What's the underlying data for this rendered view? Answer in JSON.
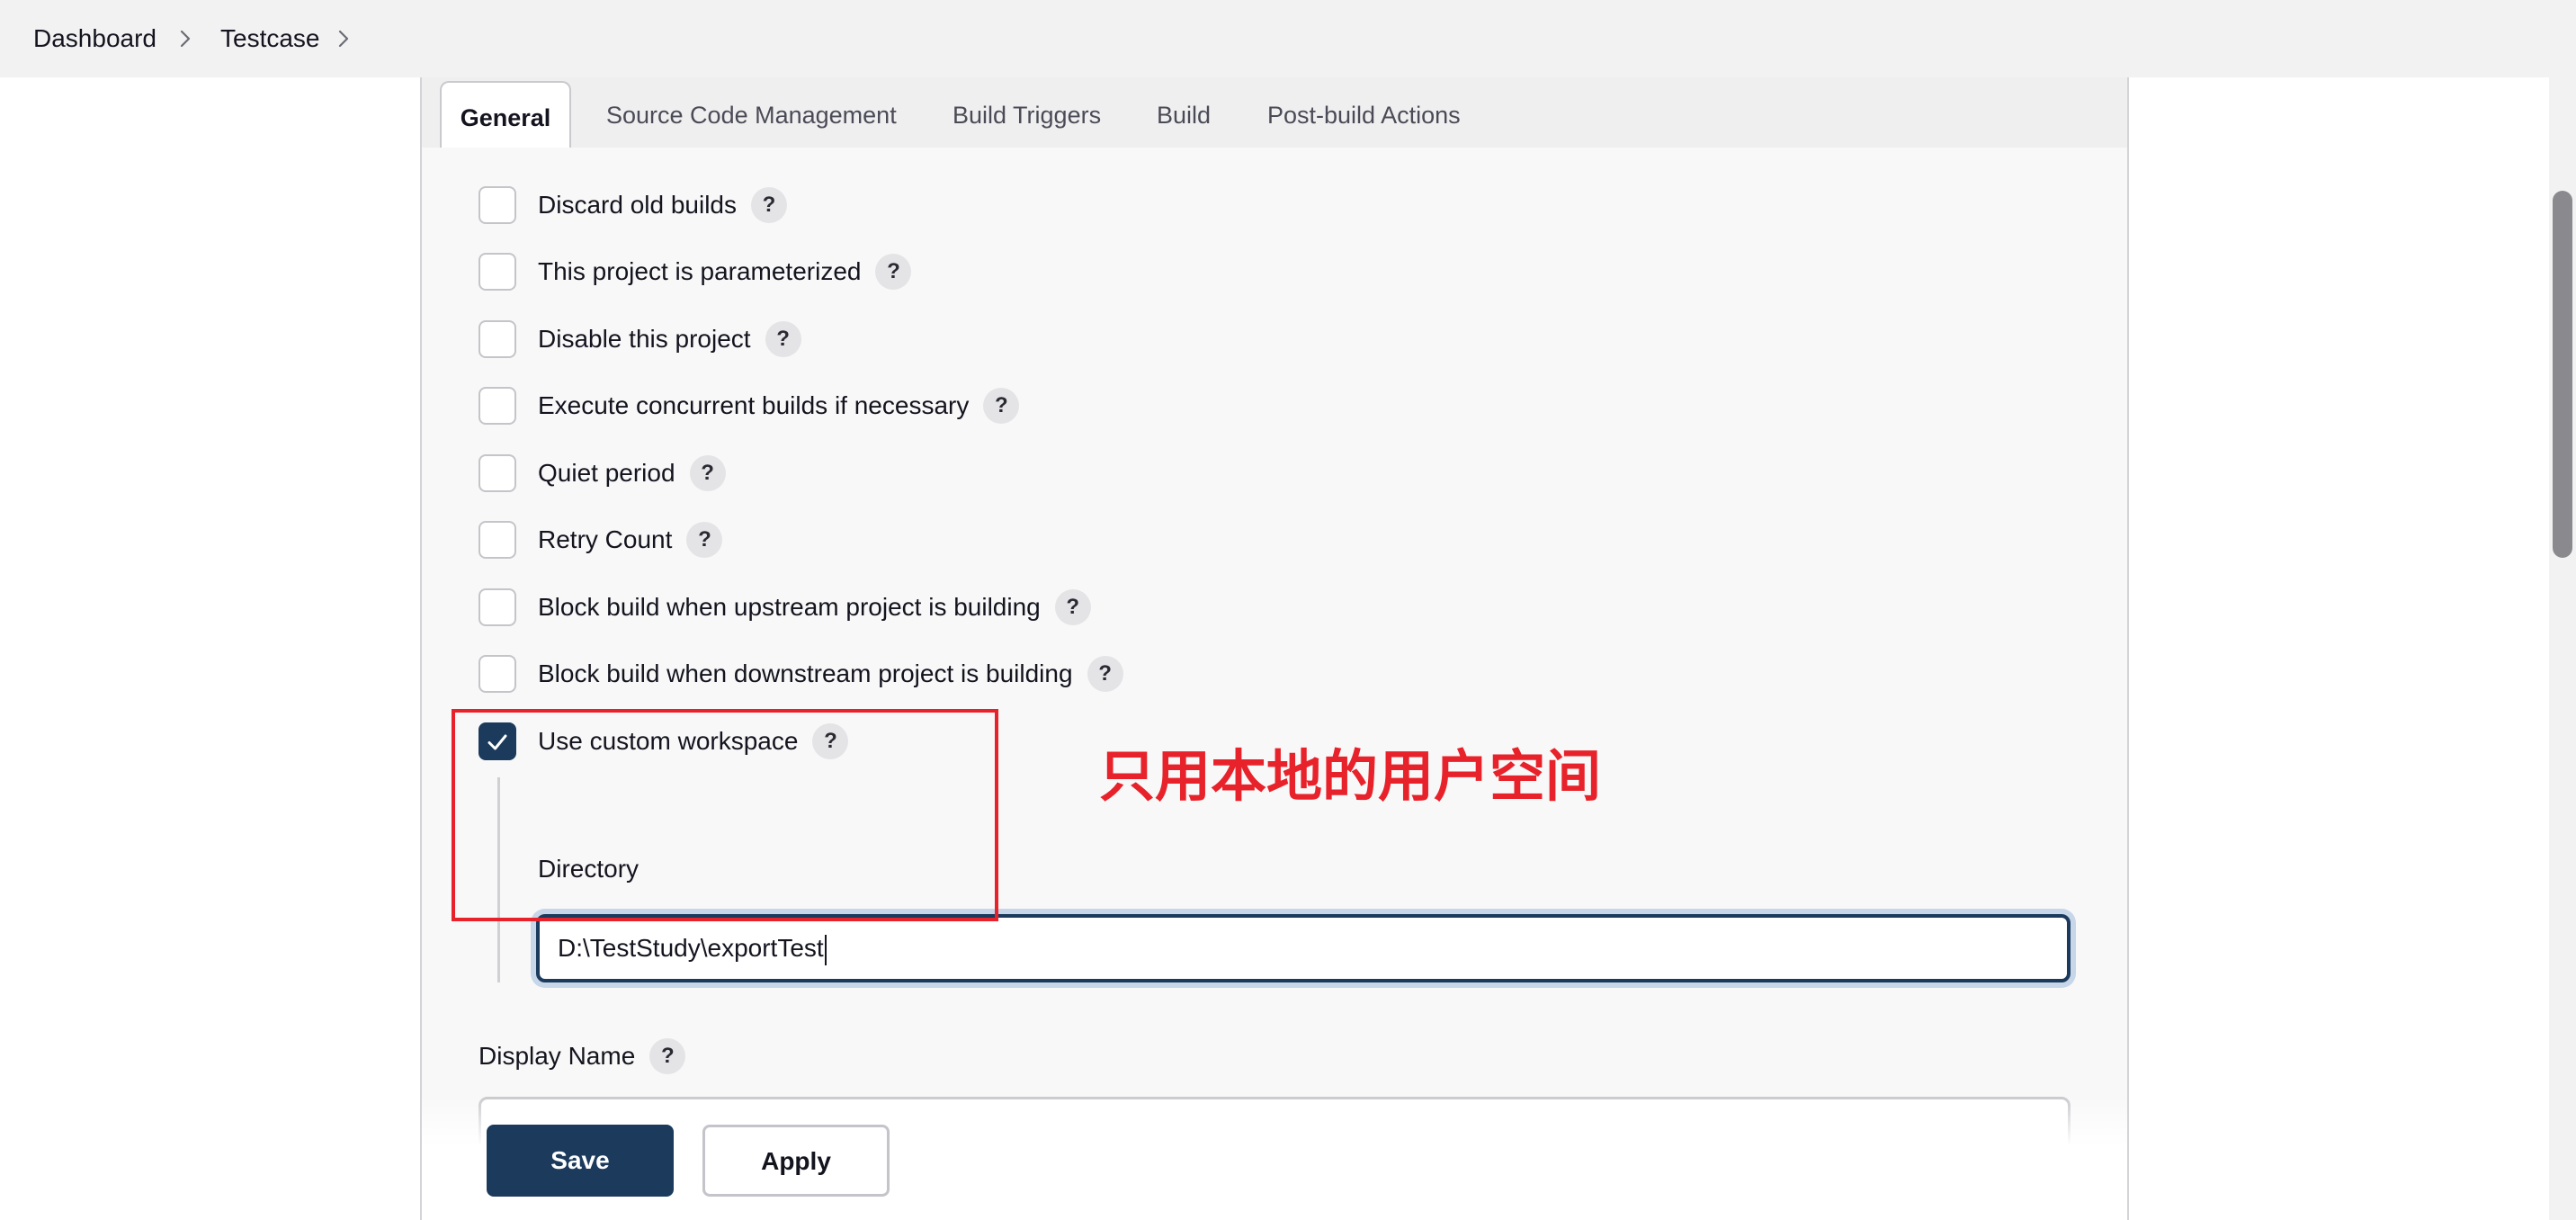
{
  "breadcrumb": {
    "items": [
      "Dashboard",
      "Testcase"
    ]
  },
  "tabs": [
    {
      "label": "General",
      "active": true
    },
    {
      "label": "Source Code Management",
      "active": false
    },
    {
      "label": "Build Triggers",
      "active": false
    },
    {
      "label": "Build",
      "active": false
    },
    {
      "label": "Post-build Actions",
      "active": false
    }
  ],
  "options": [
    {
      "label": "Discard old builds",
      "checked": false
    },
    {
      "label": "This project is parameterized",
      "checked": false
    },
    {
      "label": "Disable this project",
      "checked": false
    },
    {
      "label": "Execute concurrent builds if necessary",
      "checked": false
    },
    {
      "label": "Quiet period",
      "checked": false
    },
    {
      "label": "Retry Count",
      "checked": false
    },
    {
      "label": "Block build when upstream project is building",
      "checked": false
    },
    {
      "label": "Block build when downstream project is building",
      "checked": false
    },
    {
      "label": "Use custom workspace",
      "checked": true
    }
  ],
  "help_glyph": "?",
  "directory": {
    "label": "Directory",
    "value": "D:\\TestStudy\\exportTest"
  },
  "display_name": {
    "label": "Display Name",
    "value": ""
  },
  "buttons": {
    "save": "Save",
    "apply": "Apply"
  },
  "annotation": {
    "text": "只用本地的用户空间",
    "color": "#e8222a"
  },
  "colors": {
    "primary": "#1b3a5c",
    "annotation": "#e8222a"
  }
}
